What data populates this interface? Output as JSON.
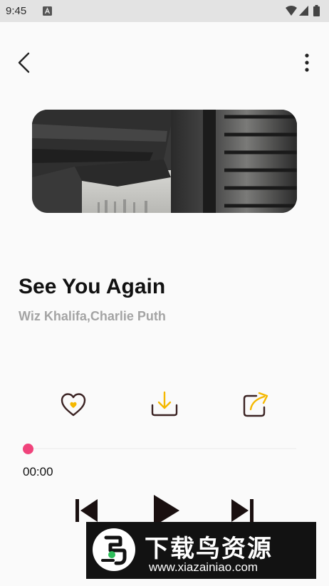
{
  "status_bar": {
    "time": "9:45",
    "icons": [
      "notification-a-icon",
      "wifi-icon",
      "cell-signal-icon",
      "battery-icon"
    ]
  },
  "toolbar": {
    "back_icon": "chevron-left-icon",
    "menu_icon": "more-vertical-icon"
  },
  "album_art": {
    "description_icon": "album-cover-image"
  },
  "song": {
    "title": "See You Again",
    "artist": "Wiz Khalifa,Charlie Puth"
  },
  "actions": [
    {
      "name": "like",
      "icon": "heart-icon"
    },
    {
      "name": "download",
      "icon": "download-icon"
    },
    {
      "name": "share",
      "icon": "share-icon"
    }
  ],
  "playback": {
    "current_time": "00:00",
    "progress": 0
  },
  "controls": [
    {
      "name": "previous",
      "icon": "skip-previous-icon"
    },
    {
      "name": "play",
      "icon": "play-icon"
    },
    {
      "name": "next",
      "icon": "skip-next-icon"
    }
  ],
  "watermark": {
    "name": "下载鸟资源",
    "url": "www.xiazainiao.com"
  },
  "colors": {
    "accent": "#f0437b",
    "icon_dark": "#3b2323",
    "icon_accent": "#f5b800",
    "title": "#111111",
    "artist": "#a4a4a4",
    "background": "#fafafa",
    "status_bar": "#e3e3e3"
  }
}
